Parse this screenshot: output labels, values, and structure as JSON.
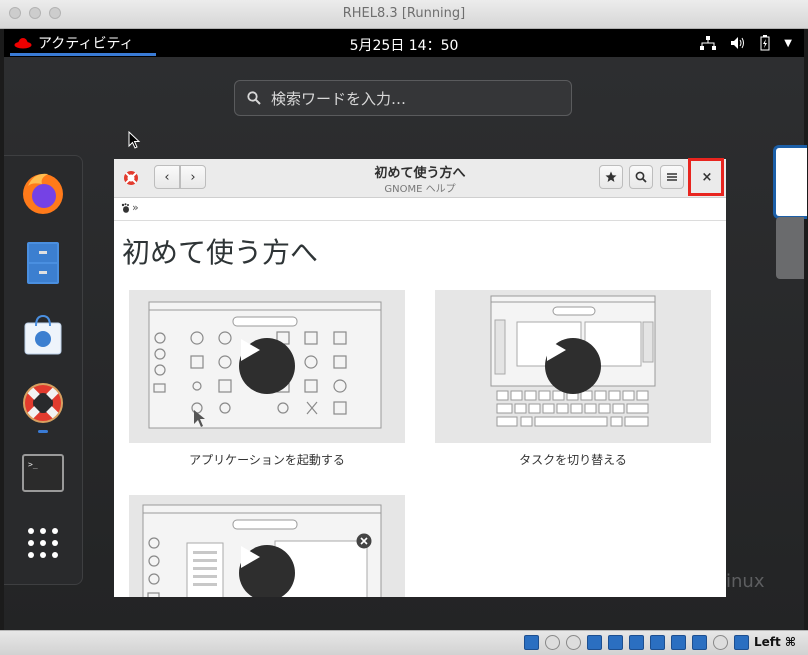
{
  "mac_window": {
    "title": "RHEL8.3 [Running]"
  },
  "topbar": {
    "activities_label": "アクティビティ",
    "clock": "5月25日 14：50"
  },
  "search": {
    "placeholder": "検索ワードを入力…"
  },
  "dock": {
    "items": [
      {
        "name": "firefox"
      },
      {
        "name": "files"
      },
      {
        "name": "software"
      },
      {
        "name": "help",
        "running": true
      },
      {
        "name": "terminal"
      },
      {
        "name": "show-applications"
      }
    ]
  },
  "help_window": {
    "title": "初めて使う方へ",
    "subtitle": "GNOME ヘルプ",
    "breadcrumb": "»",
    "heading": "初めて使う方へ",
    "close_label": "×",
    "videos": [
      {
        "caption": "アプリケーションを起動する"
      },
      {
        "caption": "タスクを切り替える"
      },
      {
        "caption": ""
      }
    ]
  },
  "background_text": "inux",
  "vbox_status": {
    "host_key": "Left ⌘"
  },
  "colors": {
    "highlight": "#e8251f",
    "accent": "#3a7bd5"
  }
}
